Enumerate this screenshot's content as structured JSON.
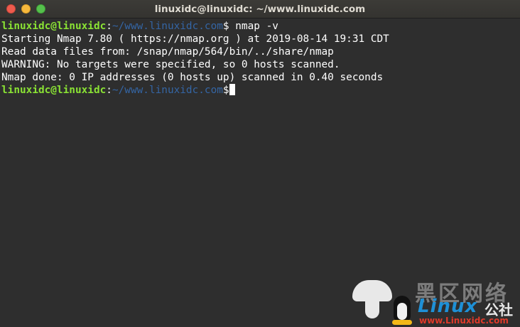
{
  "window": {
    "title": "linuxidc@linuxidc: ~/www.linuxidc.com"
  },
  "terminal": {
    "prompt_user": "linuxidc@linuxidc",
    "prompt_sep": ":",
    "prompt_path": "~/www.linuxidc.com",
    "prompt_symbol": "$",
    "command": " nmap -v",
    "output": [
      "Starting Nmap 7.80 ( https://nmap.org ) at 2019-08-14 19:31 CDT",
      "Read data files from: /snap/nmap/564/bin/../share/nmap",
      "WARNING: No targets were specified, so 0 hosts scanned.",
      "Nmap done: 0 IP addresses (0 hosts up) scanned in 0.40 seconds"
    ]
  },
  "watermark": {
    "brand": "黑区网络",
    "linux": "Linux",
    "gongshe": "公社",
    "url": "www.Linuxidc.com"
  },
  "colors": {
    "prompt_user": "#8ae234",
    "prompt_path": "#3465a4",
    "text": "#ffffff",
    "background": "#2e2e2e",
    "close": "#ef5b4d",
    "minimize": "#f6b83c",
    "maximize": "#55c04c"
  }
}
